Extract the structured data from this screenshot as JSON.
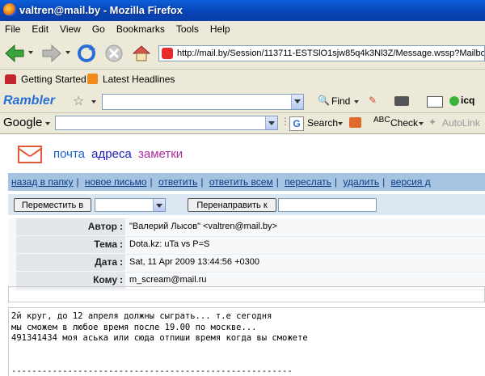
{
  "window": {
    "title": "valtren@mail.by - Mozilla Firefox"
  },
  "menu": [
    "File",
    "Edit",
    "View",
    "Go",
    "Bookmarks",
    "Tools",
    "Help"
  ],
  "address": {
    "url": "http://mail.by/Session/113711-ESTSlO1sjw85q4k3Nl3Z/Message.wssp?Mailbox="
  },
  "bookmarks": [
    {
      "label": "Getting Started",
      "icon": "firefox-icon"
    },
    {
      "label": "Latest Headlines",
      "icon": "rss-icon"
    }
  ],
  "rambler_toolbar": {
    "brand": "Rambler",
    "find_label": "Find",
    "icq_label": "icq"
  },
  "google_toolbar": {
    "brand": "Google",
    "search_label": "Search",
    "check_label": "Check",
    "autolink_label": "AutoLink"
  },
  "mail": {
    "nav": {
      "pochta": "почта",
      "adresa": "адреса",
      "zametki": "заметки"
    },
    "actions": [
      "назад в папку",
      "новое письмо",
      "ответить",
      "ответить всем",
      "переслать",
      "удалить",
      "версия д"
    ],
    "move_button": "Переместить в",
    "redirect_button": "Перенаправить к",
    "headers": [
      {
        "label": "Автор",
        "value": "\"Валерий Лысов\" <valtren@mail.by>"
      },
      {
        "label": "Тема",
        "value": "Dota.kz: uTa vs P=S"
      },
      {
        "label": "Дата",
        "value": "Sat, 11 Apr 2009 13:44:56 +0300"
      },
      {
        "label": "Кому",
        "value": "m_scream@mail.ru"
      }
    ],
    "body": "2й круг, до 12 апреля должны сыграть... т.е сегодня\nмы сможем в любое время после 19.00 по москве...\n491341434 моя аська или сюда отпиши время когда вы сможете\n\n\n-------------------------------------------------------"
  },
  "colors": {
    "title_bar": "#0846b8",
    "action_bar": "#a6c3e2",
    "link": "#0b3c86",
    "nav_pochta": "#1a5fd0",
    "nav_adresa": "#1a1ac0",
    "nav_zametki": "#b02aa0"
  }
}
